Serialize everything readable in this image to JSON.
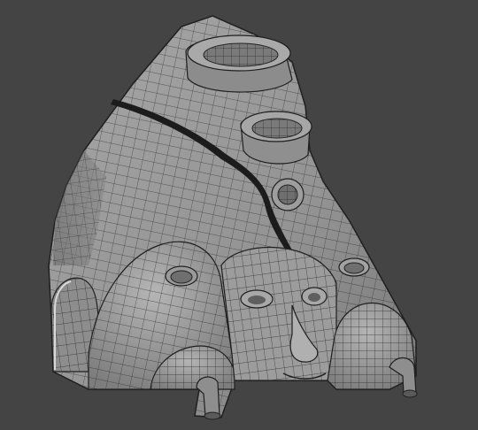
{
  "viewport": {
    "background": "#444444",
    "shading": "flat-gray-with-wireframe",
    "mesh_color": "#222222",
    "surface_color": "#9a9a9a",
    "surface_highlight": "#b8b8b8",
    "surface_shadow": "#5f5f5f"
  },
  "model": {
    "object": "stone-face-dwelling",
    "features": [
      "domed-roof-cap",
      "chimney-vent-top",
      "chimney-vent-middle",
      "round-window-center",
      "dark-crack-band",
      "left-arched-doorway",
      "left-dome",
      "right-dome",
      "carved-face",
      "left-pipe",
      "right-pipe",
      "small-vent-left",
      "small-vent-right"
    ]
  }
}
